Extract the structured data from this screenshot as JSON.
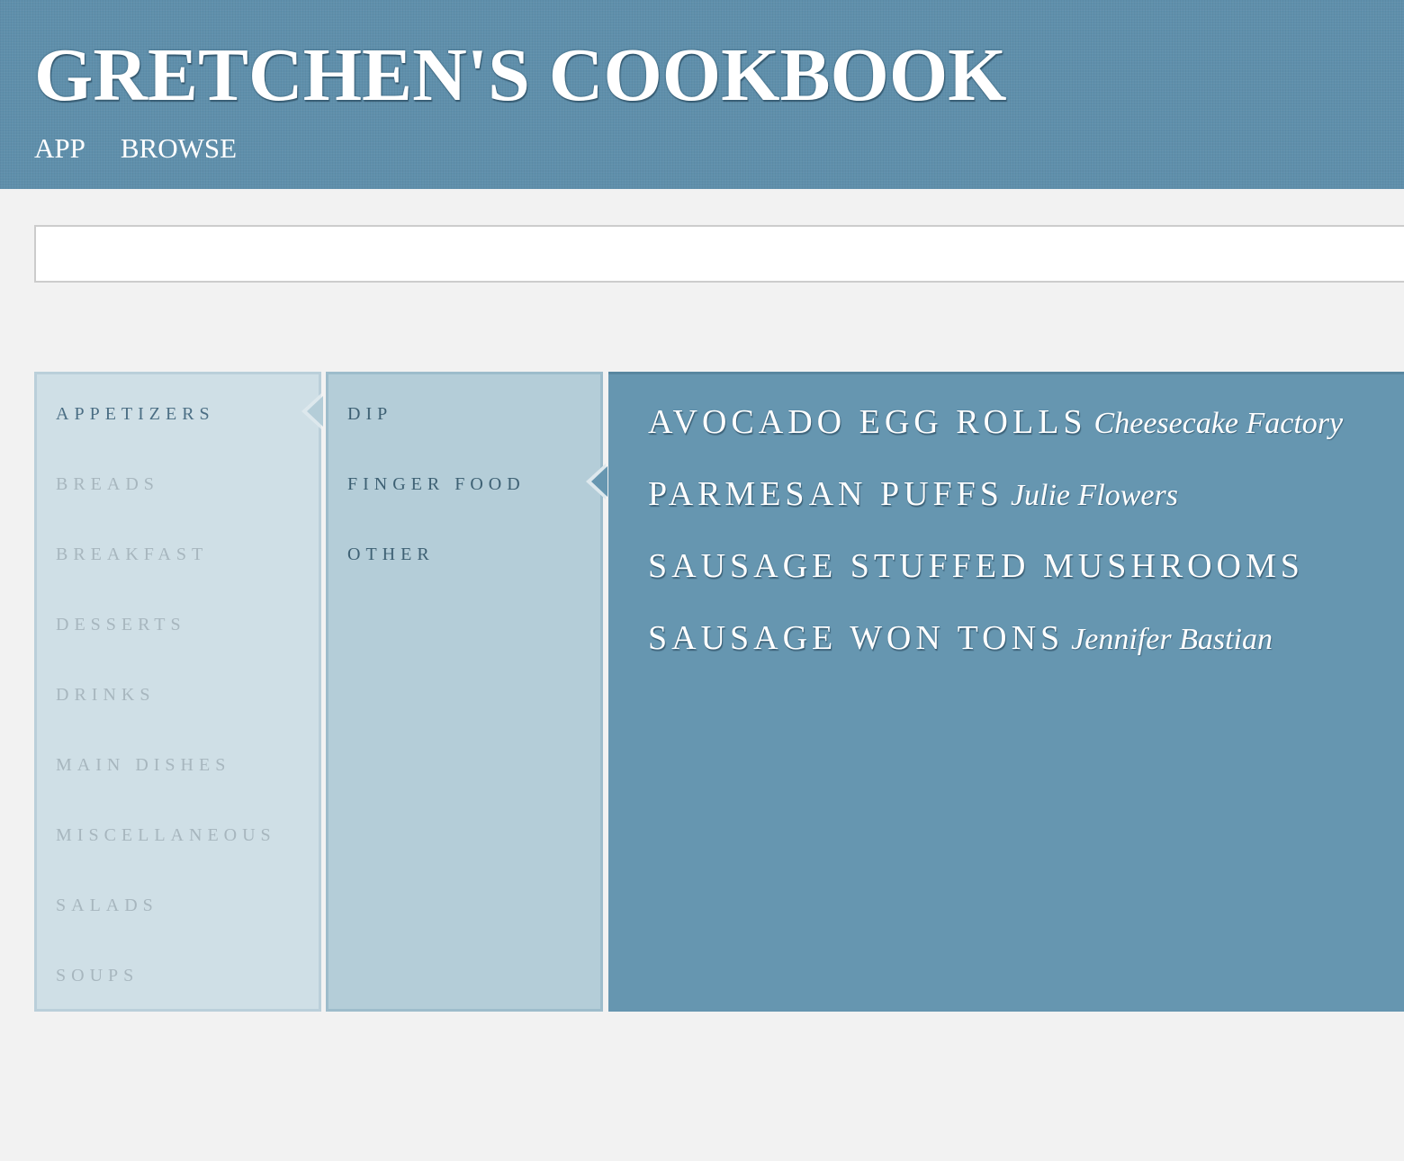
{
  "header": {
    "title": "GRETCHEN'S COOKBOOK",
    "nav": [
      {
        "label": "APP"
      },
      {
        "label": "BROWSE"
      }
    ]
  },
  "search": {
    "value": "",
    "placeholder": ""
  },
  "categories": {
    "selected": "APPETIZERS",
    "items": [
      {
        "label": "APPETIZERS"
      },
      {
        "label": "BREADS"
      },
      {
        "label": "BREAKFAST"
      },
      {
        "label": "DESSERTS"
      },
      {
        "label": "DRINKS"
      },
      {
        "label": "MAIN DISHES"
      },
      {
        "label": "MISCELLANEOUS"
      },
      {
        "label": "SALADS"
      },
      {
        "label": "SOUPS"
      }
    ]
  },
  "subcategories": {
    "selected": "FINGER FOOD",
    "items": [
      {
        "label": "DIP"
      },
      {
        "label": "FINGER FOOD"
      },
      {
        "label": "OTHER"
      }
    ]
  },
  "recipes": {
    "items": [
      {
        "name": "AVOCADO EGG ROLLS",
        "author": "Cheesecake Factory"
      },
      {
        "name": "PARMESAN PUFFS",
        "author": "Julie Flowers"
      },
      {
        "name": "SAUSAGE STUFFED MUSHROOMS",
        "author": ""
      },
      {
        "name": "SAUSAGE WON TONS",
        "author": "Jennifer Bastian"
      }
    ]
  },
  "colors": {
    "header_bg": "#5f8fab",
    "page_bg": "#f2f2f2",
    "categories_bg": "#cfdfe6",
    "subcategories_bg": "#b4cdd8",
    "recipes_bg": "#6696b0",
    "active_text": "#4b6e84",
    "inactive_text": "#a7b6be"
  }
}
